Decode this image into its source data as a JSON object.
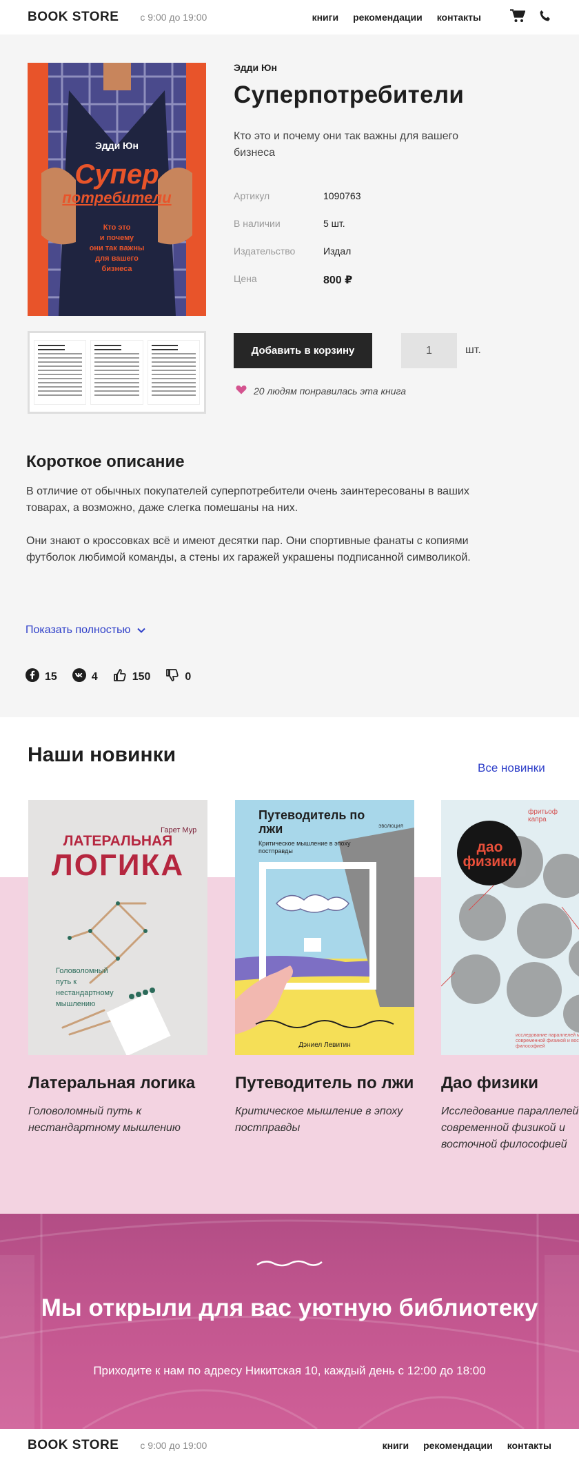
{
  "header": {
    "logo": "BOOK STORE",
    "hours": "с 9:00 до 19:00",
    "nav": [
      "книги",
      "рекомендации",
      "контакты"
    ]
  },
  "product": {
    "author": "Эдди Юн",
    "title": "Суперпотребители",
    "subtitle": "Кто это и почему они так важны для вашего бизнеса",
    "cover": {
      "author": "Эдди Юн",
      "title_line1": "Супер",
      "title_line2": "потребители",
      "tagline": [
        "Кто это",
        "и почему",
        "они так важны",
        "для вашего",
        "бизнеса"
      ]
    },
    "props": [
      {
        "label": "Артикул",
        "value": "1090763"
      },
      {
        "label": "В наличии",
        "value": "5 шт."
      },
      {
        "label": "Издательство",
        "value": "Издал"
      },
      {
        "label": "Цена",
        "value": "800 ₽"
      }
    ],
    "add_to_cart": "Добавить в корзину",
    "quantity": "1",
    "unit": "шт.",
    "likes_text": "20 людям понравилась эта книга"
  },
  "description": {
    "title": "Короткое описание",
    "paragraphs": [
      "В отличие от обычных покупателей суперпотребители очень заинтересованы в ваших товарах, а возможно, даже слегка помешаны на них.",
      "Они знают о кроссовках всё и имеют десятки пар. Они спортивные фанаты с копиями футболок любимой команды, а стены их гаражей украшены подписанной символикой."
    ],
    "show_more": "Показать полностью"
  },
  "social": {
    "facebook": "15",
    "vk": "4",
    "likes": "150",
    "dislikes": "0"
  },
  "news": {
    "title": "Наши новинки",
    "all_link": "Все новинки",
    "books": [
      {
        "title": "Латеральная логика",
        "desc": "Головоломный путь к нестандартному мышлению",
        "cover_author": "Гарет Мур",
        "cover_title1": "ЛАТЕРАЛЬНАЯ",
        "cover_title2": "ЛОГИКА",
        "cover_sub": "Головоломный путь к нестандартному мышлению"
      },
      {
        "title": "Путеводитель по лжи",
        "desc": "Критическое мышление в эпоху постправды",
        "cover_title": "Путеводитель по лжи",
        "cover_sub": "Критическое мышление в эпоху постправды",
        "cover_author": "Дэниел Левитин",
        "cover_publisher": "ЭВОЛЮЦИЯ"
      },
      {
        "title": "Дао физики",
        "desc": "Исследование параллелей между современной физикой и восточной философией",
        "cover_title1": "дао",
        "cover_title2": "физики",
        "cover_author": "фритьоф капра",
        "cover_sub": "исследование параллелей между современной физикой и восточной философией"
      }
    ]
  },
  "promo": {
    "title": "Мы открыли для вас уютную библиотеку",
    "subtitle": "Приходите к нам по адресу Никитская 10, каждый день с 12:00 до 18:00"
  },
  "footer": {
    "logo": "BOOK STORE",
    "hours": "с 9:00 до 19:00",
    "nav": [
      "книги",
      "рекомендации",
      "контакты"
    ]
  }
}
